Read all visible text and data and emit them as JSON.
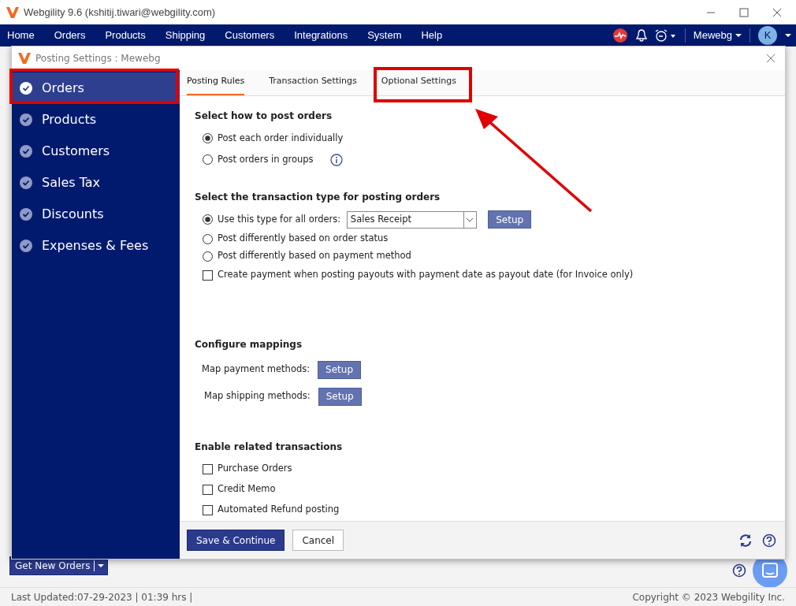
{
  "window": {
    "title": "Webgility 9.6 (kshitij.tiwari@webgility.com)"
  },
  "menu": [
    {
      "label": "Home"
    },
    {
      "label": "Orders"
    },
    {
      "label": "Products"
    },
    {
      "label": "Shipping"
    },
    {
      "label": "Customers"
    },
    {
      "label": "Integrations"
    },
    {
      "label": "System"
    },
    {
      "label": "Help"
    }
  ],
  "header_right": {
    "user": "Mewebg",
    "avatar": "K"
  },
  "dialog": {
    "title": "Posting Settings : Mewebg",
    "sidebar": [
      {
        "label": "Orders",
        "selected": true
      },
      {
        "label": "Products",
        "selected": false
      },
      {
        "label": "Customers",
        "selected": false
      },
      {
        "label": "Sales Tax",
        "selected": false
      },
      {
        "label": "Discounts",
        "selected": false
      },
      {
        "label": "Expenses & Fees",
        "selected": false
      }
    ],
    "tabs": [
      {
        "label": "Posting Rules",
        "selected": true
      },
      {
        "label": "Transaction Settings",
        "selected": false
      },
      {
        "label": "Optional Settings",
        "selected": false
      }
    ],
    "sections": [
      {
        "heading": "Select how to post orders",
        "rows": [
          {
            "kind": "radio",
            "label": "Post each order individually",
            "selected": true
          },
          {
            "kind": "radio",
            "label": "Post orders in groups",
            "selected": false,
            "info": true
          }
        ]
      },
      {
        "heading": "Select the transaction type for posting orders",
        "rows": [
          {
            "kind": "radio",
            "label": "Use this type for all orders:",
            "selected": true,
            "select_value": "Sales Receipt",
            "button": "Setup"
          },
          {
            "kind": "radio",
            "label": "Post differently based on order status",
            "selected": false
          },
          {
            "kind": "radio",
            "label": "Post differently based on payment method",
            "selected": false
          },
          {
            "kind": "checkbox",
            "label": "Create payment when posting payouts with payment date as payout date (for Invoice only)",
            "checked": false
          }
        ]
      },
      {
        "heading": "Configure mappings",
        "rows": [
          {
            "kind": "mapping",
            "label": "Map payment methods:",
            "button": "Setup"
          },
          {
            "kind": "mapping",
            "label": "Map shipping methods:",
            "button": "Setup"
          }
        ]
      },
      {
        "heading": "Enable related transactions",
        "rows": [
          {
            "kind": "checkbox",
            "label": "Purchase Orders",
            "checked": false
          },
          {
            "kind": "checkbox",
            "label": "Credit Memo",
            "checked": false
          },
          {
            "kind": "checkbox",
            "label": "Automated Refund posting",
            "checked": false
          }
        ]
      }
    ],
    "buttons": [
      {
        "label": "Save & Continue",
        "kind": "primary"
      },
      {
        "label": "Cancel",
        "kind": "secondary"
      }
    ]
  },
  "get_new_orders": "Get New Orders",
  "status_bar": {
    "left": "Last Updated:07-29-2023 | 01:39 hrs |",
    "right": "Copyright © 2023 Webgility Inc."
  }
}
